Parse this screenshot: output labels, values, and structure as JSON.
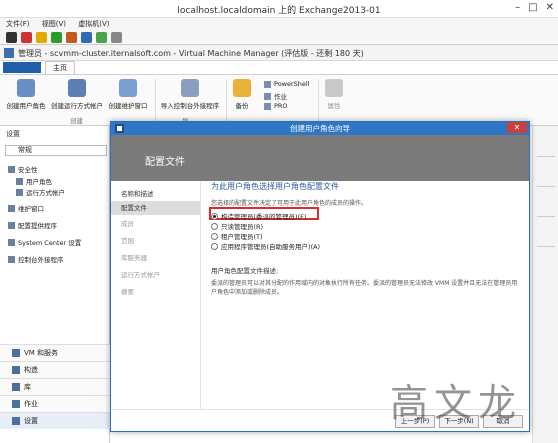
{
  "host": {
    "title": "localhost.localdomain 上的 Exchange2013-01",
    "menu": [
      "文件(F)",
      "视图(V)",
      "虚拟机(V)"
    ]
  },
  "vmm": {
    "title": "管理员 - scvmm-cluster.iternalsoft.com - Virtual Machine Manager (评估版 - 还剩 180 天)",
    "tab_home": "主页",
    "ribbon": {
      "create_user_role": "创建用户角色",
      "create_runas": "创建运行方式帐户",
      "create_maint": "创建维护窗口",
      "group_create": "创建",
      "import_console": "导入控制台外接程序",
      "group_import": "导",
      "backup": "备份",
      "powershell": "PowerShell",
      "jobs": "作业",
      "pro": "PRO",
      "properties": "属性",
      "group_props": "属性"
    },
    "nav": {
      "header": "设置",
      "search": "常规",
      "items": [
        "安全性",
        "用户角色",
        "运行方式帐户",
        "维护窗口",
        "配置提供程序",
        "System Center 设置",
        "控制台外接程序"
      ],
      "workspaces": [
        "VM 和服务",
        "构造",
        "库",
        "作业",
        "设置"
      ]
    }
  },
  "dialog": {
    "title": "创建用户角色向导",
    "banner": "配置文件",
    "steps": [
      "名称和描述",
      "配置文件",
      "成员",
      "范围",
      "库服务器",
      "运行方式帐户",
      "摘要"
    ],
    "heading": "为此用户角色选择用户角色配置文件",
    "desc": "您选择的配置文件决定了可用于此用户角色的成员的操作。",
    "options": [
      "构造管理员(委派的管理员)(F)",
      "只读管理员(R)",
      "租户管理员(T)",
      "应用程序管理员(自助服务用户)(A)"
    ],
    "desc_label": "用户角色配置文件描述:",
    "desc_text": "委派的管理员可以对其分配的作用域内的对象执行所有任务。委派的管理员无法修改 VMM 设置并且无法在管理员用户角色中添加或删除成员。",
    "btn_prev": "上一步(P)",
    "btn_next": "下一步(N)",
    "btn_cancel": "取消"
  },
  "watermark": "高文龙",
  "colors": {
    "dialog_title": "#2f76c6",
    "banner": "#7b7b7b",
    "highlight": "#e02a2a"
  }
}
